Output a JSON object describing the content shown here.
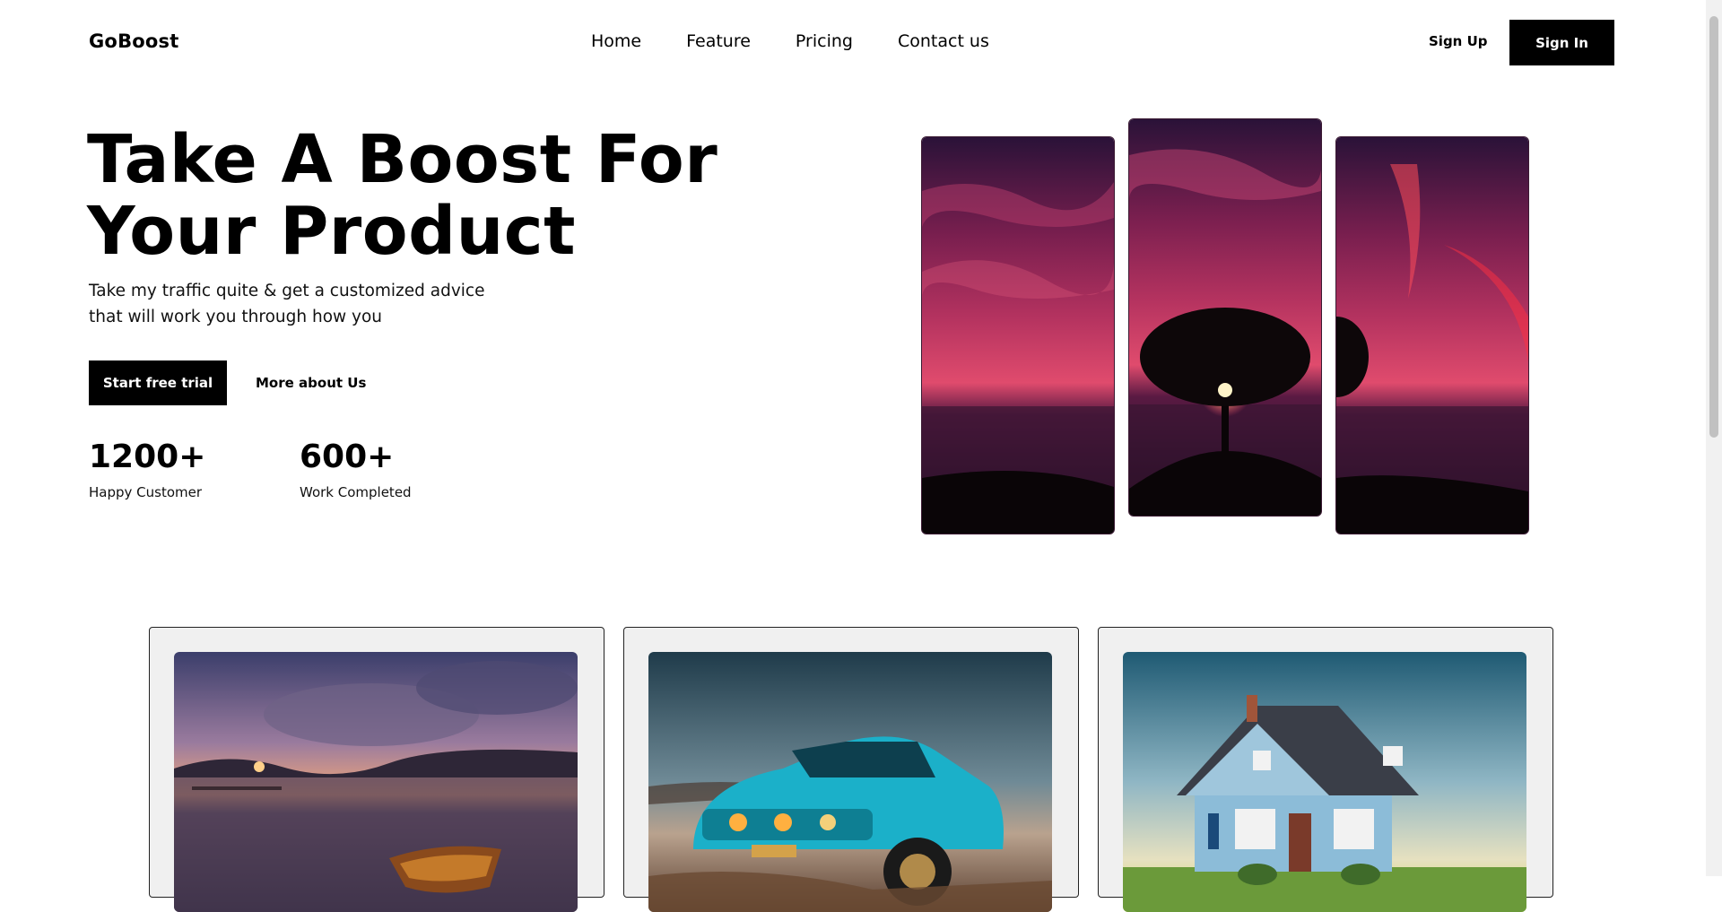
{
  "nav": {
    "logo": "GoBoost",
    "menu": [
      "Home",
      "Feature",
      "Pricing",
      "Contact us"
    ],
    "sign_up": "Sign Up",
    "sign_in": "Sign In"
  },
  "hero": {
    "title_line1": "Take A Boost For",
    "title_line2": "Your Product",
    "subtitle_line1": "Take my traffic quite & get a customized advice",
    "subtitle_line2": "that will work you through how you",
    "primary_button": "Start free trial",
    "secondary_button": "More about Us",
    "stats": [
      {
        "value": "1200+",
        "label": "Happy Customer"
      },
      {
        "value": "600+",
        "label": "Work Completed"
      }
    ]
  },
  "images": {
    "hero_panels": [
      "sunset-tree-panel-left",
      "sunset-tree-panel-center",
      "sunset-tree-panel-right"
    ],
    "cards": [
      "lake-sunset-boat-image",
      "blue-muscle-car-image",
      "blue-house-image"
    ]
  },
  "colors": {
    "primary": "#000000",
    "background": "#ffffff",
    "card_background": "#f0f0f0"
  }
}
